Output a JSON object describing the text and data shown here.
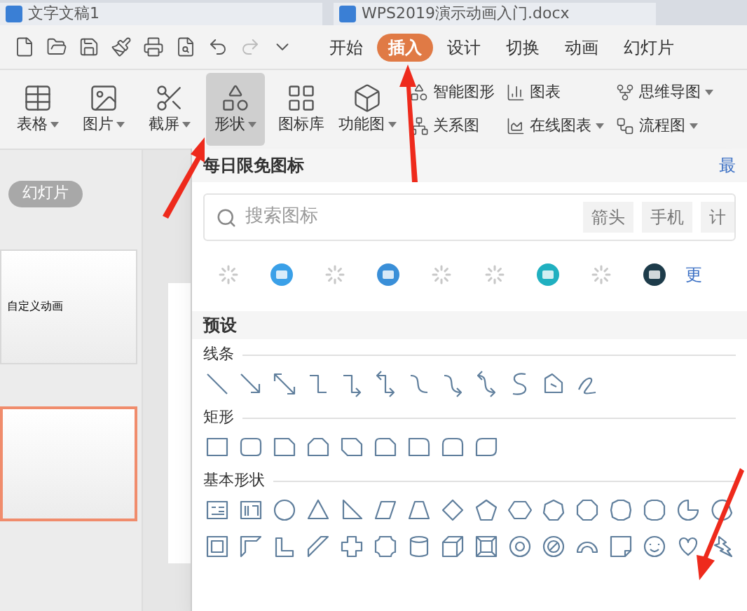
{
  "document_tabs": [
    {
      "title": "文字文稿1"
    },
    {
      "title": "WPS2019演示动画入门.docx"
    }
  ],
  "menu_tabs": [
    {
      "label": "开始",
      "selected": false
    },
    {
      "label": "插入",
      "selected": true
    },
    {
      "label": "设计",
      "selected": false
    },
    {
      "label": "切换",
      "selected": false
    },
    {
      "label": "动画",
      "selected": false
    },
    {
      "label": "幻灯片",
      "selected": false
    }
  ],
  "ribbon": {
    "large_buttons": [
      {
        "label": "表格",
        "dropdown": true,
        "selected": false
      },
      {
        "label": "图片",
        "dropdown": true,
        "selected": false
      },
      {
        "label": "截屏",
        "dropdown": true,
        "selected": false
      },
      {
        "label": "形状",
        "dropdown": true,
        "selected": true
      },
      {
        "label": "图标库",
        "dropdown": false,
        "selected": false
      },
      {
        "label": "功能图",
        "dropdown": true,
        "selected": false
      }
    ],
    "small_buttons": [
      {
        "label": "智能图形",
        "dropdown": false
      },
      {
        "label": "关系图",
        "dropdown": false
      },
      {
        "label": "图表",
        "dropdown": false
      },
      {
        "label": "在线图表",
        "dropdown": true
      },
      {
        "label": "思维导图",
        "dropdown": true
      },
      {
        "label": "流程图",
        "dropdown": true
      }
    ]
  },
  "slides_panel": {
    "label": "幻灯片",
    "slides": [
      {
        "title": "自定义动画",
        "selected": false
      },
      {
        "selected": true
      }
    ]
  },
  "shape_panel": {
    "title": "每日限免图标",
    "recent_link": "最",
    "search": {
      "placeholder": "搜索图标"
    },
    "chips": [
      "箭头",
      "手机",
      "计"
    ],
    "free_icons": [
      {
        "kind": "loading"
      },
      {
        "kind": "icon",
        "color": "#3aa0e8"
      },
      {
        "kind": "loading"
      },
      {
        "kind": "icon",
        "color": "#3a8fd8"
      },
      {
        "kind": "loading"
      },
      {
        "kind": "loading"
      },
      {
        "kind": "icon",
        "color": "#20b0c0"
      },
      {
        "kind": "loading"
      },
      {
        "kind": "icon",
        "color": "#1d3b4a"
      }
    ],
    "more_link": "更",
    "preset_title": "预设",
    "sections": [
      {
        "title": "线条",
        "kind": "lines"
      },
      {
        "title": "矩形",
        "kind": "rectangles"
      },
      {
        "title": "基本形状",
        "kind": "basic"
      }
    ]
  }
}
